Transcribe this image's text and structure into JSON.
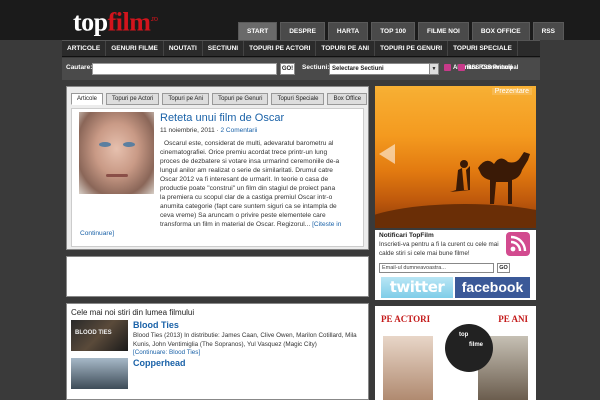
{
  "logo": {
    "part1": "top",
    "part2": "film",
    "tld": ".ro"
  },
  "top_nav": [
    "START",
    "DESPRE",
    "HARTA",
    "TOP 100",
    "FILME NOI",
    "BOX OFFICE",
    "RSS"
  ],
  "main_nav": [
    "ARTICOLE",
    "GENURI FILME",
    "NOUTATI",
    "SECTIUNI",
    "TOPURI PE ACTORI",
    "TOPURI PE ANI",
    "TOPURI PE GENURI",
    "TOPURI SPECIALE"
  ],
  "search": {
    "label": "Cautare:",
    "value": "",
    "go_label": "GO!",
    "section_label": "Sectiuni:",
    "section_selected": "Selectare Sectiuni",
    "rss_main": "Abonare RSS Principal",
    "rss_comments": "RSS Comentarii"
  },
  "content_tabs": [
    "Articole",
    "Topuri pe Actori",
    "Topuri pe Ani",
    "Topuri pe Genuri",
    "Topuri Speciale",
    "Box Office"
  ],
  "featured": {
    "title": "Reteta unui film de Oscar",
    "date": "11 noiembrie, 2011",
    "separator": "·",
    "comments": "2 Comentarii",
    "lines_indented": [
      "Oscarul este, considerat de multi, adevaratul barometru al",
      "cinematografiei. Orice premiu acordat trece printr-un lung",
      "proces de dezbatere si votare insa urmarind ceremoniile de-a",
      "lungul anilor am realizat o serie de similaritati. Drumul catre",
      "Oscar 2012 va fi interesant de urmarit. In teorie o casa de",
      "productie poate \"construi\" un film din stagiul de proiect pana",
      "la premiera cu scopul clar de a castiga premiul Oscar intr-o"
    ],
    "lines_full": [
      "anumita categorie (fapt care suntem siguri ca se intampla de",
      "ceva vreme) Sa aruncam o privire peste elementele care",
      "transforma un film in material de Oscar. Regizorul..."
    ],
    "read_more": "[Citeste in",
    "read_more_end": "Continuare]"
  },
  "news": {
    "heading": "Cele mai noi stiri din lumea filmului",
    "items": [
      {
        "title": "Blood Ties",
        "thumb_label": "BLOOD TIES",
        "text": "Blood Ties (2013) In distributie: James Caan, Clive Owen, Marilon Cotillard, Mila Kunis, John Ventimiglia (The Sopranos), Yul Vasquez (Magic City)",
        "link": "[Continuare: Blood Ties]"
      },
      {
        "title": "Copperhead",
        "thumb_label": "",
        "text": "",
        "link": ""
      }
    ]
  },
  "promo": {
    "label": "Prezentare"
  },
  "newsletter": {
    "title": "Notificari TopFilm",
    "text": "Inscrieti-va pentru a fi la curent cu cele mai calde stiri si cele mai bune filme!",
    "placeholder": "Email-ul dumneavoastra...",
    "go_label": "GO"
  },
  "social": {
    "twitter": "twitter",
    "facebook": "facebook"
  },
  "banner": {
    "left": "PE ACTORI",
    "right": "PE ANI",
    "top": "top",
    "film": "filme"
  },
  "colors": {
    "accent": "#d2141c",
    "link": "#1a62a8",
    "header_bg": "#1b1b1b",
    "body_bg": "#3a3a3a"
  }
}
